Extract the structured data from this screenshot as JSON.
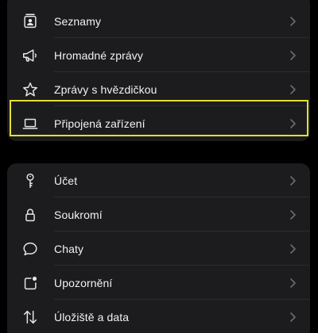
{
  "colors": {
    "background": "#000000",
    "group_bg": "#1c1c1e",
    "text": "#f2f2f2",
    "icon": "#e6e6e6",
    "chevron": "#6b6b70",
    "divider": "#2c2c2e",
    "highlight": "#e3df2f"
  },
  "group1": {
    "items": [
      {
        "label": "Seznamy",
        "icon": "contact-list-icon"
      },
      {
        "label": "Hromadné zprávy",
        "icon": "megaphone-icon"
      },
      {
        "label": "Zprávy s hvězdičkou",
        "icon": "star-icon"
      },
      {
        "label": "Připojená zařízení",
        "icon": "laptop-icon",
        "highlighted": true
      }
    ]
  },
  "group2": {
    "items": [
      {
        "label": "Účet",
        "icon": "key-icon"
      },
      {
        "label": "Soukromí",
        "icon": "lock-icon"
      },
      {
        "label": "Chaty",
        "icon": "chat-bubble-icon"
      },
      {
        "label": "Upozornění",
        "icon": "notification-icon"
      },
      {
        "label": "Úložiště a data",
        "icon": "data-arrows-icon"
      }
    ]
  }
}
